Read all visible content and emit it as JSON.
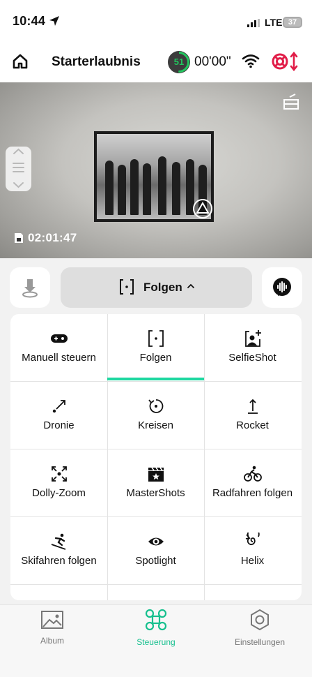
{
  "status_bar": {
    "time": "10:44",
    "network": "LTE",
    "battery": "37"
  },
  "header": {
    "title": "Starterlaubnis",
    "drone_battery": "51",
    "flight_time": "00'00\""
  },
  "camera": {
    "record_time": "02:01:47"
  },
  "mode_bar": {
    "current_mode": "Folgen"
  },
  "modes": [
    {
      "label": "Manuell steuern",
      "icon": "gamepad-icon"
    },
    {
      "label": "Folgen",
      "icon": "follow-bracket-icon",
      "active": true
    },
    {
      "label": "SelfieShot",
      "icon": "selfie-icon"
    },
    {
      "label": "Dronie",
      "icon": "dronie-arrow-icon"
    },
    {
      "label": "Kreisen",
      "icon": "circle-rotate-icon"
    },
    {
      "label": "Rocket",
      "icon": "rocket-up-icon"
    },
    {
      "label": "Dolly-Zoom",
      "icon": "dolly-zoom-icon"
    },
    {
      "label": "MasterShots",
      "icon": "clapperboard-icon"
    },
    {
      "label": "Radfahren folgen",
      "icon": "cyclist-icon"
    },
    {
      "label": "Skifahren folgen",
      "icon": "skier-icon"
    },
    {
      "label": "Spotlight",
      "icon": "eye-icon"
    },
    {
      "label": "Helix",
      "icon": "helix-icon"
    }
  ],
  "tabs": [
    {
      "label": "Album",
      "icon": "album-icon"
    },
    {
      "label": "Steuerung",
      "icon": "drone-control-icon",
      "active": true
    },
    {
      "label": "Einstellungen",
      "icon": "settings-hexagon-icon"
    }
  ],
  "colors": {
    "accent": "#1ed8a0",
    "battery_green": "#22c55e",
    "rescue_red": "#e11d48"
  }
}
